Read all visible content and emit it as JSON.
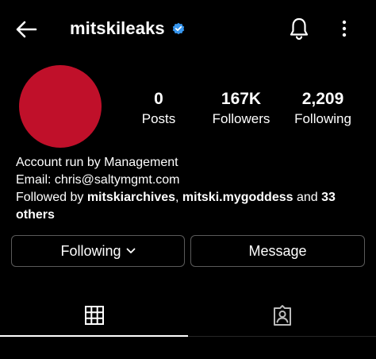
{
  "header": {
    "username": "mitskileaks",
    "verified_color": "#3897f0"
  },
  "profile": {
    "avatar_color": "#c0102a"
  },
  "stats": {
    "posts": {
      "value": "0",
      "label": "Posts"
    },
    "followers": {
      "value": "167K",
      "label": "Followers"
    },
    "following": {
      "value": "2,209",
      "label": "Following"
    }
  },
  "bio": {
    "line1": "Account run by Management",
    "line2": "Email: chris@saltymgmt.com",
    "followed_prefix": "Followed by ",
    "followed_user1": "mitskiarchives",
    "followed_sep": ", ",
    "followed_user2": "mitski.mygoddess",
    "followed_and": " and ",
    "followed_others": "33 others"
  },
  "actions": {
    "following_label": "Following",
    "message_label": "Message"
  },
  "tabs": {
    "active": "grid",
    "items": [
      {
        "id": "grid",
        "icon": "grid-icon"
      },
      {
        "id": "tagged",
        "icon": "tagged-person-icon"
      }
    ]
  }
}
